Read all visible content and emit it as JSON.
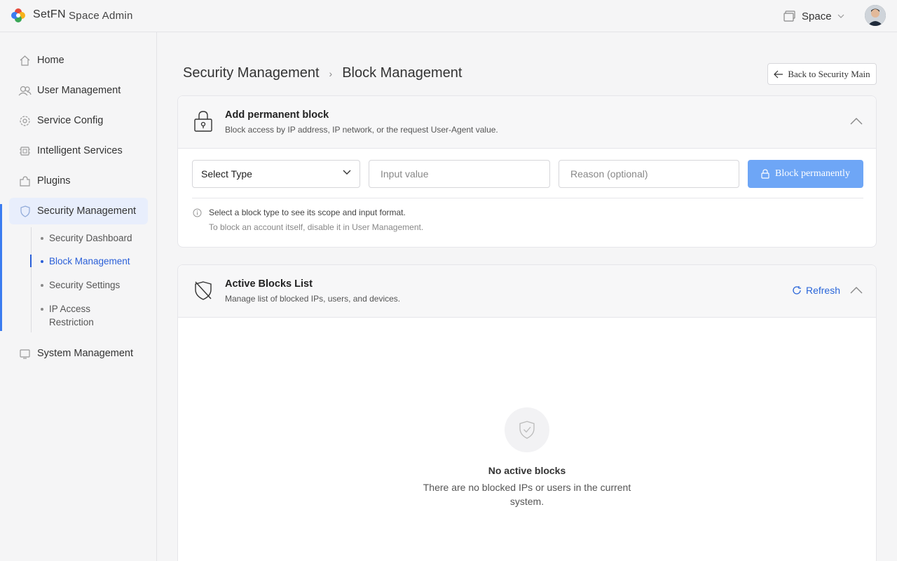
{
  "topbar": {
    "brand": "SetFN",
    "subtitle": "Space Admin",
    "space_label": "Space"
  },
  "sidebar": {
    "items": [
      {
        "label": "Home",
        "icon": "home-icon"
      },
      {
        "label": "User Management",
        "icon": "users-icon"
      },
      {
        "label": "Service Config",
        "icon": "gear-icon"
      },
      {
        "label": "Intelligent Services",
        "icon": "chip-icon"
      },
      {
        "label": "Plugins",
        "icon": "puzzle-icon"
      },
      {
        "label": "Security Management",
        "icon": "shield-icon"
      },
      {
        "label": "System Management",
        "icon": "monitor-icon"
      }
    ],
    "security_sub": [
      {
        "label": "Security Dashboard"
      },
      {
        "label": "Block Management"
      },
      {
        "label": "Security Settings"
      },
      {
        "label": "IP Access Restriction"
      }
    ]
  },
  "breadcrumb": {
    "parent": "Security Management",
    "current": "Block Management"
  },
  "back_button": "Back to Security Main",
  "add_block": {
    "title": "Add permanent block",
    "description": "Block access by IP address, IP network, or the request User-Agent value.",
    "select_value": "Select Type",
    "input_placeholder": "Input value",
    "reason_placeholder": "Reason (optional)",
    "submit_label": "Block permanently",
    "hint_primary": "Select a block type to see its scope and input format.",
    "hint_secondary": "To block an account itself, disable it in User Management."
  },
  "active_blocks": {
    "title": "Active Blocks List",
    "description": "Manage list of blocked IPs, users, and devices.",
    "refresh_label": "Refresh",
    "empty_title": "No active blocks",
    "empty_description": "There are no blocked IPs or users in the current system."
  },
  "colors": {
    "accent": "#2a5fd8",
    "button": "#6ea6f6",
    "active_bg": "#e8eefc"
  }
}
